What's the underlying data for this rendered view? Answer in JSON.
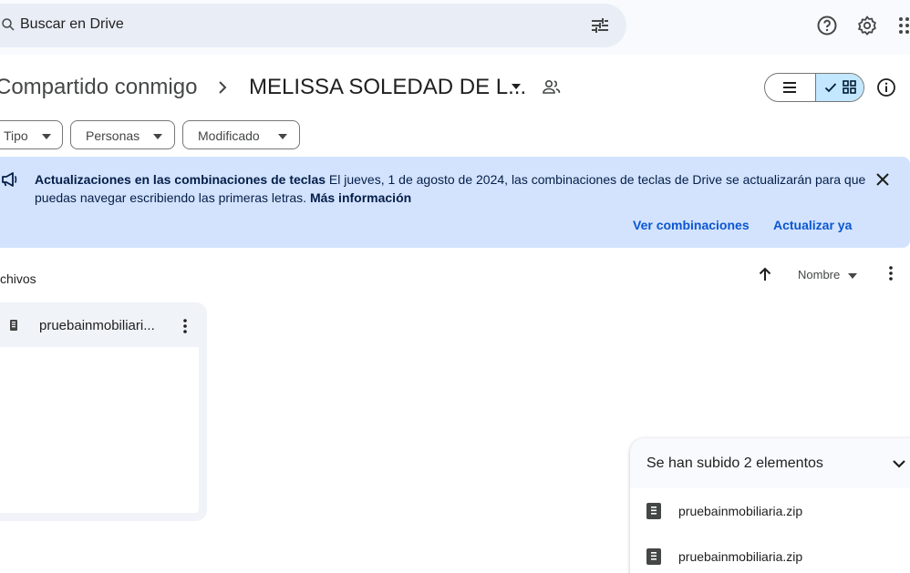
{
  "search": {
    "placeholder": "Buscar en Drive"
  },
  "breadcrumb": {
    "parent": "Compartido conmigo",
    "current": "MELISSA SOLEDAD DE L..."
  },
  "filters": [
    {
      "label": "Tipo"
    },
    {
      "label": "Personas"
    },
    {
      "label": "Modificado"
    }
  ],
  "banner": {
    "title": "Actualizaciones en las combinaciones de teclas",
    "body": "El jueves, 1 de agosto de 2024, las combinaciones de teclas de Drive se actualizarán para que puedas navegar escribiendo las primeras letras.",
    "link": "Más información",
    "action_primary": "Ver combinaciones",
    "action_secondary": "Actualizar ya"
  },
  "files_section": {
    "title": "Archivos",
    "sort_label": "Nombre"
  },
  "files": [
    {
      "name": "pruebainmobiliari..."
    }
  ],
  "upload_panel": {
    "title": "Se han subido 2 elementos",
    "items": [
      {
        "name": "pruebainmobiliaria.zip"
      },
      {
        "name": "pruebainmobiliaria.zip"
      }
    ]
  },
  "colors": {
    "accent": "#0b57d0",
    "banner_bg": "#d3e3fd",
    "selected_view": "#c2e7ff",
    "surface": "#f0f4f9"
  }
}
